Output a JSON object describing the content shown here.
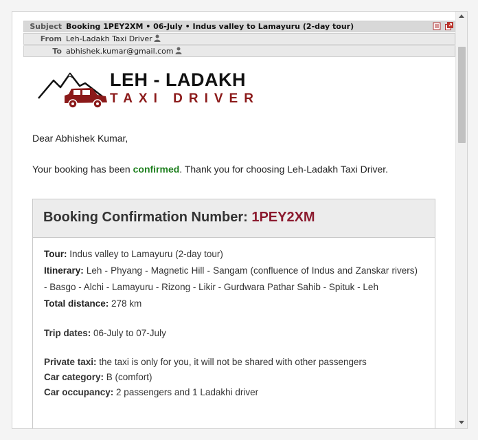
{
  "email": {
    "subject_label": "Subject",
    "subject": "Booking 1PEY2XM • 06-July • Indus valley to Lamayuru (2-day tour)",
    "from_label": "From",
    "from": "Leh-Ladakh Taxi Driver",
    "to_label": "To",
    "to": "abhishek.kumar@gmail.com"
  },
  "logo": {
    "line1": "LEH - LADAKH",
    "line2": "TAXI DRIVER"
  },
  "body": {
    "greeting": "Dear  Abhishek Kumar,",
    "intro_before": "Your booking has been ",
    "intro_confirmed": "confirmed",
    "intro_after": ". Thank you for choosing Leh-Ladakh Taxi Driver."
  },
  "booking": {
    "header_label": "Booking Confirmation Number: ",
    "number": "1PEY2XM",
    "tour_label": "Tour:",
    "tour": " Indus valley to Lamayuru (2-day tour)",
    "itinerary_label": "Itinerary:",
    "itinerary": " Leh - Phyang - Magnetic Hill - Sangam (confluence of Indus and Zanskar rivers) - Basgo - Alchi - Lamayuru - Rizong - Likir - Gurdwara Pathar Sahib - Spituk - Leh",
    "distance_label": "Total distance:",
    "distance": " 278 km",
    "dates_label": "Trip dates:",
    "dates": " 06-July to 07-July",
    "private_label": "Private taxi:",
    "private": " the taxi is only for you, it will not be shared with other passengers",
    "category_label": "Car category:",
    "category": " B (comfort)",
    "occupancy_label": "Car occupancy:",
    "occupancy": " 2 passengers and 1 Ladakhi driver"
  },
  "colors": {
    "confirmed": "#1e7f1e",
    "booking_number": "#8b1a2e",
    "logo_red": "#8b1a1a"
  },
  "icons": [
    "person-icon",
    "print-icon",
    "open-new-window-icon",
    "car-icon",
    "mountain-icon"
  ]
}
